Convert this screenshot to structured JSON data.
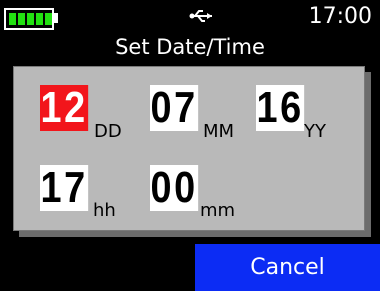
{
  "status_bar": {
    "battery_icon": "battery-full-icon",
    "battery_color": "#22e011",
    "usb_icon": "usb-icon",
    "time": "17:00"
  },
  "screen": {
    "title": "Set Date/Time"
  },
  "fields": {
    "day": {
      "value": "12",
      "unit": "DD"
    },
    "month": {
      "value": "07",
      "unit": "MM"
    },
    "year": {
      "value": "16",
      "unit": "YY"
    },
    "hour": {
      "value": "17",
      "unit": "hh"
    },
    "minute": {
      "value": "00",
      "unit": "mm"
    }
  },
  "active_field_color": "#f2151b",
  "cancel_button": {
    "label": "Cancel",
    "color": "#0c2cf4"
  }
}
